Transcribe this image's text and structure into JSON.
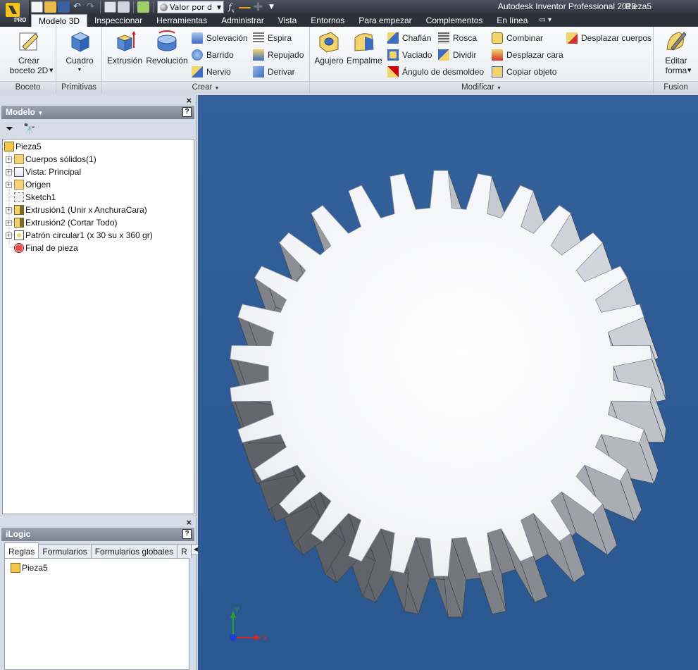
{
  "app": {
    "title": "Autodesk Inventor Professional 2013",
    "document": "Pieza5",
    "badge": "PRO",
    "appearance_value": "Valor por d"
  },
  "ribbon": {
    "tabs": [
      {
        "label": "Modelo 3D",
        "active": true
      },
      {
        "label": "Inspeccionar"
      },
      {
        "label": "Herramientas"
      },
      {
        "label": "Administrar"
      },
      {
        "label": "Vista"
      },
      {
        "label": "Entornos"
      },
      {
        "label": "Para empezar"
      },
      {
        "label": "Complementos"
      },
      {
        "label": "En línea"
      }
    ],
    "groups": {
      "boceto": {
        "label": "Boceto",
        "create_sketch_l1": "Crear",
        "create_sketch_l2": "boceto 2D"
      },
      "primitivas": {
        "label": "Primitivas",
        "box": "Cuadro"
      },
      "crear": {
        "label": "Crear",
        "extrude": "Extrusión",
        "revolve": "Revolución",
        "loft": "Solevación",
        "sweep": "Barrido",
        "rib": "Nervio",
        "coil": "Espira",
        "emboss": "Repujado",
        "derive": "Derivar"
      },
      "modificar": {
        "label": "Modificar",
        "hole": "Agujero",
        "fillet": "Empalme",
        "chamfer": "Chaflán",
        "shell": "Vaciado",
        "draft": "Ángulo de desmoldeo",
        "thread": "Rosca",
        "split": "Dividir",
        "combine": "Combinar",
        "move_face": "Desplazar cara",
        "copy_object": "Copiar objeto",
        "move_bodies": "Desplazar cuerpos"
      },
      "fusion": {
        "label": "Fusion",
        "edit_form_l1": "Editar",
        "edit_form_l2": "forma"
      }
    }
  },
  "model_panel": {
    "title": "Modelo",
    "help": "?",
    "close": "×",
    "tree": [
      {
        "label": "Pieza5",
        "icon": "part-icon",
        "expander": false,
        "indent": 0
      },
      {
        "label": "Cuerpos sólidos(1)",
        "icon": "folder-icon",
        "expander": true,
        "indent": 1
      },
      {
        "label": "Vista: Principal",
        "icon": "view-rep-icon",
        "expander": true,
        "indent": 1
      },
      {
        "label": "Origen",
        "icon": "folder-icon",
        "expander": true,
        "indent": 1
      },
      {
        "label": "Sketch1",
        "icon": "sketch-icon",
        "expander": false,
        "indent": 1
      },
      {
        "label": "Extrusión1 (Unir x AnchuraCara)",
        "icon": "extrude-icon",
        "expander": true,
        "indent": 1
      },
      {
        "label": "Extrusión2 (Cortar Todo)",
        "icon": "extrude-icon",
        "expander": true,
        "indent": 1
      },
      {
        "label": "Patrón circular1 (x 30 su x 360 gr)",
        "icon": "circular-pattern-icon",
        "expander": true,
        "indent": 1
      },
      {
        "label": "Final de pieza",
        "icon": "end-of-part-icon",
        "expander": false,
        "indent": 1
      }
    ]
  },
  "ilogic_panel": {
    "title": "iLogic",
    "help": "?",
    "close": "×",
    "tabs": [
      "Reglas",
      "Formularios",
      "Formularios globales",
      "R"
    ],
    "items": [
      "Pieza5"
    ]
  },
  "viewport": {
    "background": "#2f5d96",
    "gear_teeth": 30,
    "triad": {
      "x_label": "X",
      "y_label": "Y"
    }
  }
}
